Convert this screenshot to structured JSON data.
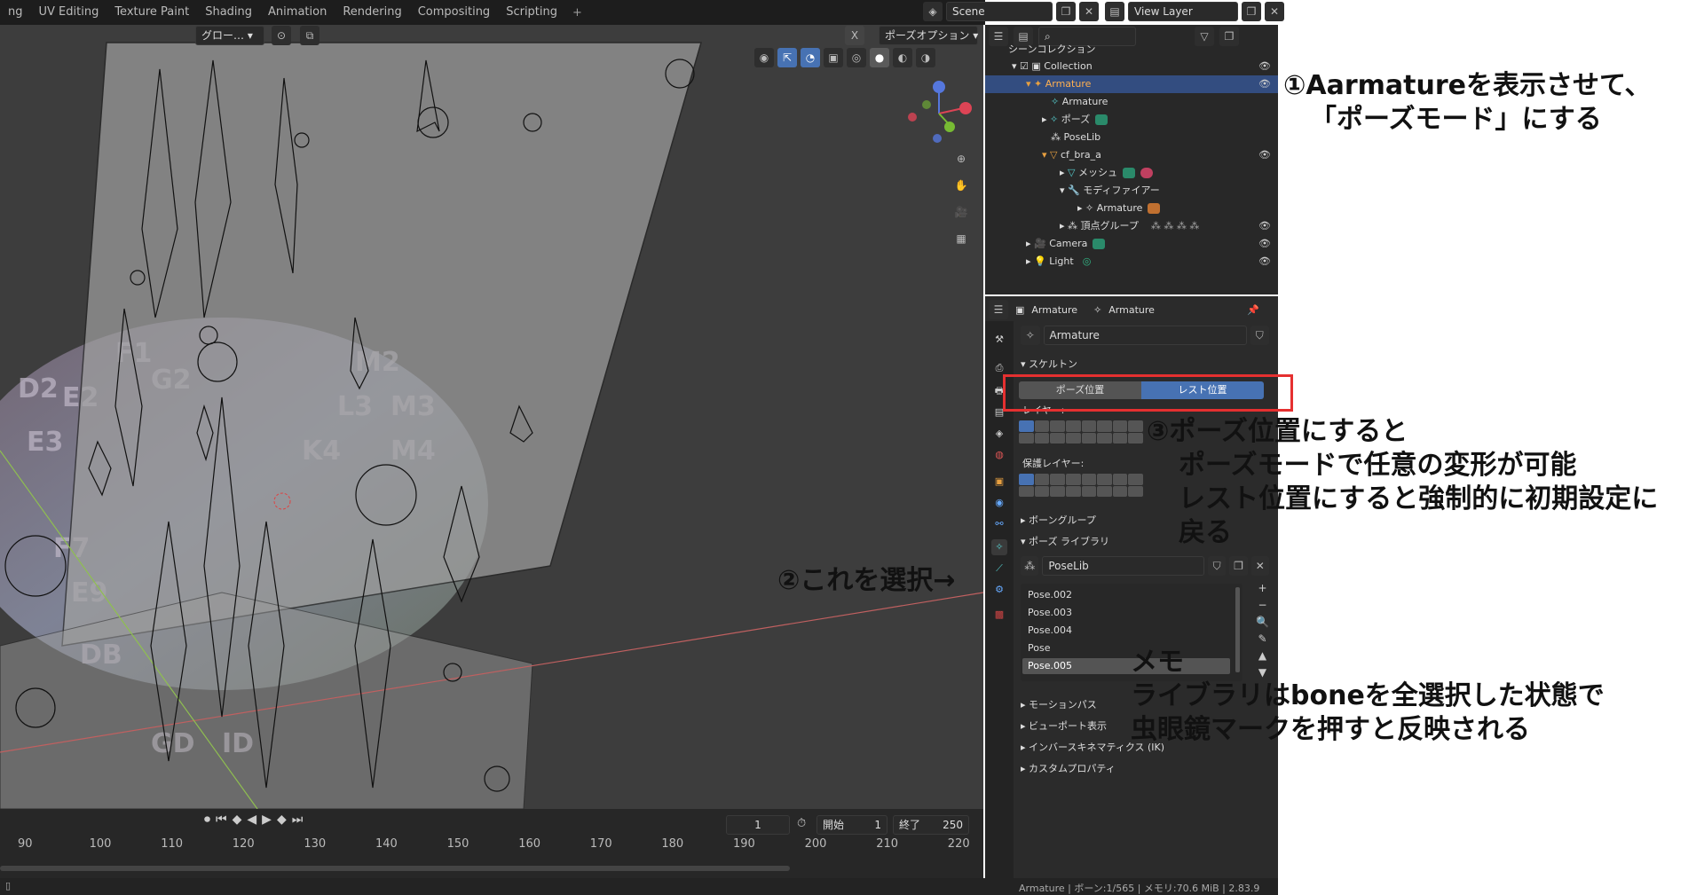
{
  "workspace_tabs": [
    "ng",
    "UV Editing",
    "Texture Paint",
    "Shading",
    "Animation",
    "Rendering",
    "Compositing",
    "Scripting"
  ],
  "scene": {
    "scene_name": "Scene",
    "view_layer": "View Layer"
  },
  "viewport": {
    "transform_orientation": "グロー…",
    "pose_options": "ポーズオプション",
    "gizmo_axes": [
      "Z",
      "Y",
      "X"
    ]
  },
  "timeline": {
    "current_frame": "1",
    "start_label": "開始",
    "start": "1",
    "end_label": "終了",
    "end": "250",
    "ruler": [
      "90",
      "100",
      "110",
      "120",
      "130",
      "140",
      "150",
      "160",
      "170",
      "180",
      "190",
      "200",
      "210",
      "220"
    ]
  },
  "outliner": {
    "scene_collection": "シーンコレクション",
    "items": [
      {
        "label": "Collection",
        "name": "collection"
      },
      {
        "label": "Armature",
        "name": "armature-object"
      },
      {
        "label": "Armature",
        "name": "armature-data"
      },
      {
        "label": "ポーズ",
        "name": "pose"
      },
      {
        "label": "PoseLib",
        "name": "poselib"
      },
      {
        "label": "cf_bra_a",
        "name": "cf-bra-a"
      },
      {
        "label": "メッシュ",
        "name": "mesh"
      },
      {
        "label": "モディファイアー",
        "name": "modifiers"
      },
      {
        "label": "Armature",
        "name": "armature-modifier"
      },
      {
        "label": "頂点グループ",
        "name": "vertex-groups"
      },
      {
        "label": "Camera",
        "name": "camera"
      },
      {
        "label": "Light",
        "name": "light"
      }
    ]
  },
  "properties": {
    "breadcrumb": [
      "Armature",
      "Armature"
    ],
    "datablock": "Armature",
    "skeleton_panel": "スケルトン",
    "pose_position": "ポーズ位置",
    "rest_position": "レスト位置",
    "layers_label": "レイヤー:",
    "protected_layers_label": "保護レイヤー:",
    "bone_groups": "ボーングループ",
    "pose_library": "ポーズ ライブラリ",
    "poselib_name": "PoseLib",
    "poses": [
      "Pose.002",
      "Pose.003",
      "Pose.004",
      "Pose",
      "Pose.005"
    ],
    "selected_pose": "Pose.005",
    "collapsed_panels": [
      "モーションパス",
      "ビューポート表示",
      "インバースキネマティクス (IK)",
      "カスタムプロパティ"
    ]
  },
  "status_bar": "Armature | ボーン:1/565 | メモリ:70.6 MiB | 2.83.9",
  "annotations": {
    "note1_line1": "①Aarmatureを表示させて、",
    "note1_line2": "「ポーズモード」にする",
    "note2": "②これを選択→",
    "note3_line1": "③ポーズ位置にすると",
    "note3_line2": "ポーズモードで任意の変形が可能",
    "note3_line3": "レスト位置にすると強制的に初期設定に",
    "note3_line4": "戻る",
    "memo_title": "メモ",
    "memo_line1": "ライブラリはboneを全選択した状態で",
    "memo_line2": "虫眼鏡マークを押すと反映される"
  },
  "colors": {
    "selection": "#334d80",
    "active_button": "#4772b3",
    "annotation_box": "#e53030",
    "text_dark": "#111111"
  }
}
